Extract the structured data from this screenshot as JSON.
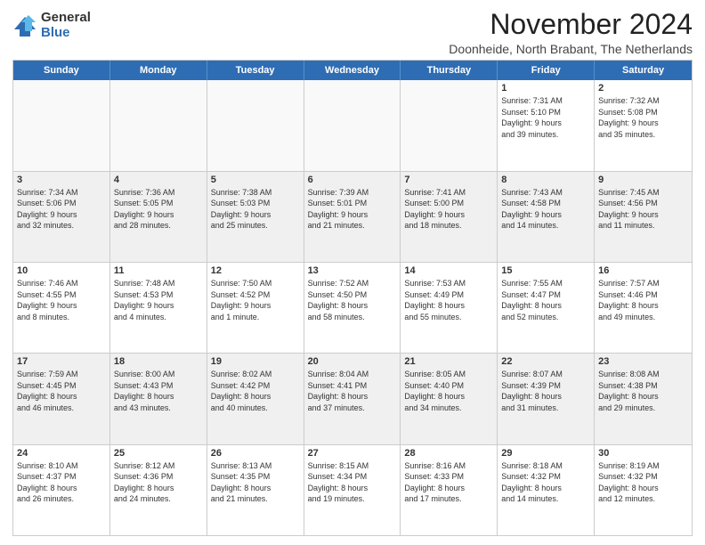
{
  "logo": {
    "general": "General",
    "blue": "Blue"
  },
  "title": "November 2024",
  "subtitle": "Doonheide, North Brabant, The Netherlands",
  "header_days": [
    "Sunday",
    "Monday",
    "Tuesday",
    "Wednesday",
    "Thursday",
    "Friday",
    "Saturday"
  ],
  "rows": [
    [
      {
        "day": "",
        "info": "",
        "empty": true
      },
      {
        "day": "",
        "info": "",
        "empty": true
      },
      {
        "day": "",
        "info": "",
        "empty": true
      },
      {
        "day": "",
        "info": "",
        "empty": true
      },
      {
        "day": "",
        "info": "",
        "empty": true
      },
      {
        "day": "1",
        "info": "Sunrise: 7:31 AM\nSunset: 5:10 PM\nDaylight: 9 hours\nand 39 minutes."
      },
      {
        "day": "2",
        "info": "Sunrise: 7:32 AM\nSunset: 5:08 PM\nDaylight: 9 hours\nand 35 minutes."
      }
    ],
    [
      {
        "day": "3",
        "info": "Sunrise: 7:34 AM\nSunset: 5:06 PM\nDaylight: 9 hours\nand 32 minutes."
      },
      {
        "day": "4",
        "info": "Sunrise: 7:36 AM\nSunset: 5:05 PM\nDaylight: 9 hours\nand 28 minutes."
      },
      {
        "day": "5",
        "info": "Sunrise: 7:38 AM\nSunset: 5:03 PM\nDaylight: 9 hours\nand 25 minutes."
      },
      {
        "day": "6",
        "info": "Sunrise: 7:39 AM\nSunset: 5:01 PM\nDaylight: 9 hours\nand 21 minutes."
      },
      {
        "day": "7",
        "info": "Sunrise: 7:41 AM\nSunset: 5:00 PM\nDaylight: 9 hours\nand 18 minutes."
      },
      {
        "day": "8",
        "info": "Sunrise: 7:43 AM\nSunset: 4:58 PM\nDaylight: 9 hours\nand 14 minutes."
      },
      {
        "day": "9",
        "info": "Sunrise: 7:45 AM\nSunset: 4:56 PM\nDaylight: 9 hours\nand 11 minutes."
      }
    ],
    [
      {
        "day": "10",
        "info": "Sunrise: 7:46 AM\nSunset: 4:55 PM\nDaylight: 9 hours\nand 8 minutes."
      },
      {
        "day": "11",
        "info": "Sunrise: 7:48 AM\nSunset: 4:53 PM\nDaylight: 9 hours\nand 4 minutes."
      },
      {
        "day": "12",
        "info": "Sunrise: 7:50 AM\nSunset: 4:52 PM\nDaylight: 9 hours\nand 1 minute."
      },
      {
        "day": "13",
        "info": "Sunrise: 7:52 AM\nSunset: 4:50 PM\nDaylight: 8 hours\nand 58 minutes."
      },
      {
        "day": "14",
        "info": "Sunrise: 7:53 AM\nSunset: 4:49 PM\nDaylight: 8 hours\nand 55 minutes."
      },
      {
        "day": "15",
        "info": "Sunrise: 7:55 AM\nSunset: 4:47 PM\nDaylight: 8 hours\nand 52 minutes."
      },
      {
        "day": "16",
        "info": "Sunrise: 7:57 AM\nSunset: 4:46 PM\nDaylight: 8 hours\nand 49 minutes."
      }
    ],
    [
      {
        "day": "17",
        "info": "Sunrise: 7:59 AM\nSunset: 4:45 PM\nDaylight: 8 hours\nand 46 minutes."
      },
      {
        "day": "18",
        "info": "Sunrise: 8:00 AM\nSunset: 4:43 PM\nDaylight: 8 hours\nand 43 minutes."
      },
      {
        "day": "19",
        "info": "Sunrise: 8:02 AM\nSunset: 4:42 PM\nDaylight: 8 hours\nand 40 minutes."
      },
      {
        "day": "20",
        "info": "Sunrise: 8:04 AM\nSunset: 4:41 PM\nDaylight: 8 hours\nand 37 minutes."
      },
      {
        "day": "21",
        "info": "Sunrise: 8:05 AM\nSunset: 4:40 PM\nDaylight: 8 hours\nand 34 minutes."
      },
      {
        "day": "22",
        "info": "Sunrise: 8:07 AM\nSunset: 4:39 PM\nDaylight: 8 hours\nand 31 minutes."
      },
      {
        "day": "23",
        "info": "Sunrise: 8:08 AM\nSunset: 4:38 PM\nDaylight: 8 hours\nand 29 minutes."
      }
    ],
    [
      {
        "day": "24",
        "info": "Sunrise: 8:10 AM\nSunset: 4:37 PM\nDaylight: 8 hours\nand 26 minutes."
      },
      {
        "day": "25",
        "info": "Sunrise: 8:12 AM\nSunset: 4:36 PM\nDaylight: 8 hours\nand 24 minutes."
      },
      {
        "day": "26",
        "info": "Sunrise: 8:13 AM\nSunset: 4:35 PM\nDaylight: 8 hours\nand 21 minutes."
      },
      {
        "day": "27",
        "info": "Sunrise: 8:15 AM\nSunset: 4:34 PM\nDaylight: 8 hours\nand 19 minutes."
      },
      {
        "day": "28",
        "info": "Sunrise: 8:16 AM\nSunset: 4:33 PM\nDaylight: 8 hours\nand 17 minutes."
      },
      {
        "day": "29",
        "info": "Sunrise: 8:18 AM\nSunset: 4:32 PM\nDaylight: 8 hours\nand 14 minutes."
      },
      {
        "day": "30",
        "info": "Sunrise: 8:19 AM\nSunset: 4:32 PM\nDaylight: 8 hours\nand 12 minutes."
      }
    ]
  ]
}
